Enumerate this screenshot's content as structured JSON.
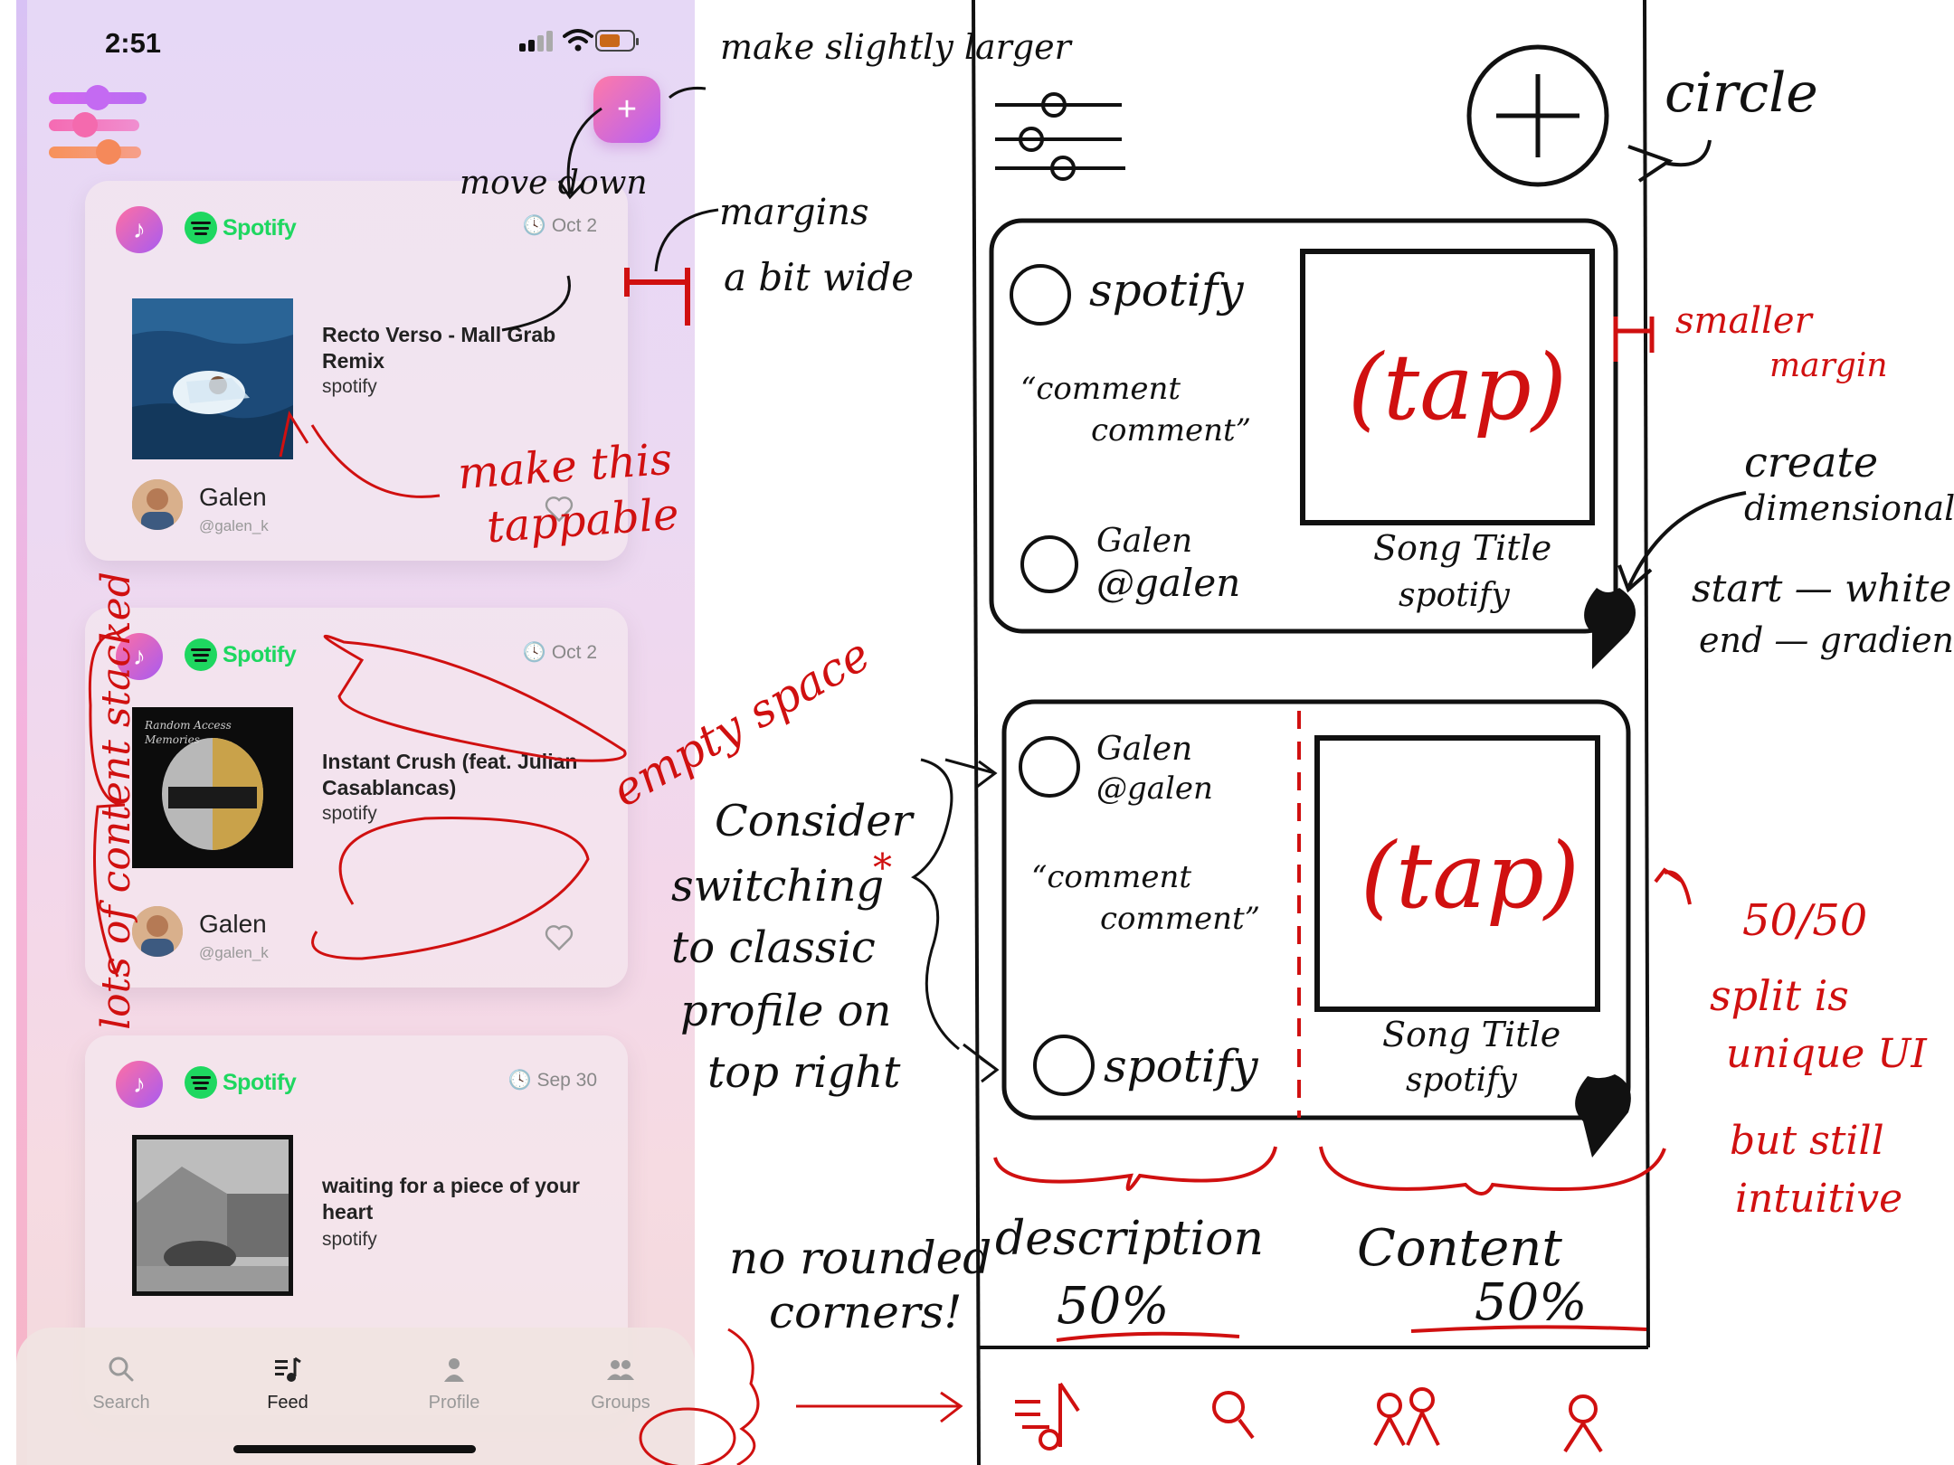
{
  "status": {
    "time": "2:51"
  },
  "feed": {
    "cards": [
      {
        "service": "Spotify",
        "date": "Oct 2",
        "title": "Recto Verso - Mall Grab Remix",
        "source": "spotify",
        "user": "Galen",
        "handle": "@galen_k"
      },
      {
        "service": "Spotify",
        "date": "Oct 2",
        "title": "Instant Crush (feat. Julian Casablancas)",
        "source": "spotify",
        "user": "Galen",
        "handle": "@galen_k"
      },
      {
        "service": "Spotify",
        "date": "Sep 30",
        "title": "waiting for a piece of your heart",
        "source": "spotify"
      }
    ]
  },
  "tabs": [
    {
      "label": "Search",
      "icon": "search-icon"
    },
    {
      "label": "Feed",
      "icon": "music-note-icon",
      "active": true
    },
    {
      "label": "Profile",
      "icon": "person-icon"
    },
    {
      "label": "Groups",
      "icon": "people-icon"
    }
  ],
  "annotations": {
    "make_larger": "make slightly larger",
    "move_down": "move down",
    "margins_1": "margins",
    "margins_2": "a bit wide",
    "tappable_1": "make this",
    "tappable_2": "tappable",
    "stacked": "lots of content stacked",
    "empty": "empty space",
    "consider_1": "Consider",
    "consider_2": "switching",
    "consider_3": "to classic",
    "consider_4": "profile on",
    "consider_5": "top right",
    "no_round_1": "no rounded",
    "no_round_2": "corners!",
    "circle": "circle",
    "smaller_1": "smaller",
    "smaller_2": "margin",
    "create_1": "create",
    "create_2": "dimensionality",
    "create_3": "start — white",
    "create_4": "end — gradient",
    "split_1": "50/50",
    "split_2": "split is",
    "split_3": "unique UI",
    "split_4": "but still",
    "split_5": "intuitive",
    "desc_label": "description",
    "desc_pct": "50%",
    "content_label": "Content",
    "content_pct": "50%"
  },
  "wireframe": {
    "card1": {
      "service": "spotify",
      "comment_1": "“comment",
      "comment_2": "comment”",
      "user_1": "Galen",
      "user_2": "@galen",
      "song": "Song Title",
      "src": "spotify",
      "tap": "(tap)"
    },
    "card2": {
      "user_1": "Galen",
      "user_2": "@galen",
      "comment_1": "“comment",
      "comment_2": "comment”",
      "service": "spotify",
      "song": "Song Title",
      "src": "spotify",
      "tap": "(tap)"
    }
  }
}
